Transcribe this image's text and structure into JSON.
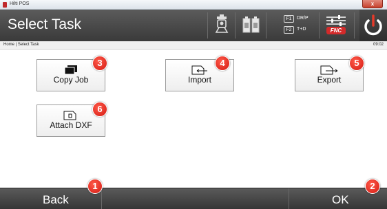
{
  "window": {
    "title": "Hilti POS",
    "close_label": "x"
  },
  "header": {
    "title": "Select Task",
    "icons": [
      "instrument-icon",
      "battery-icon",
      "function-keys-icon",
      "fnc-icon",
      "power-icon"
    ],
    "f1_key": "F1",
    "f1_label": "DR/P",
    "f2_key": "F2",
    "f2_label": "T+D",
    "fnc_label": "FNC"
  },
  "breadcrumb": {
    "path": "Home | Select Task",
    "time": "09:02"
  },
  "tasks": [
    {
      "label": "Copy Job",
      "badge": "3",
      "icon": "copy-job-icon"
    },
    {
      "label": "Import",
      "badge": "4",
      "icon": "import-icon"
    },
    {
      "label": "Export",
      "badge": "5",
      "icon": "export-icon"
    },
    {
      "label": "Attach DXF",
      "badge": "6",
      "icon": "attach-dxf-icon"
    }
  ],
  "footer": {
    "back_label": "Back",
    "back_badge": "1",
    "ok_label": "OK",
    "ok_badge": "2"
  },
  "colors": {
    "accent_red": "#d31a12",
    "header_bg": "#4a4a4a",
    "fnc_red": "#d42a2a"
  }
}
